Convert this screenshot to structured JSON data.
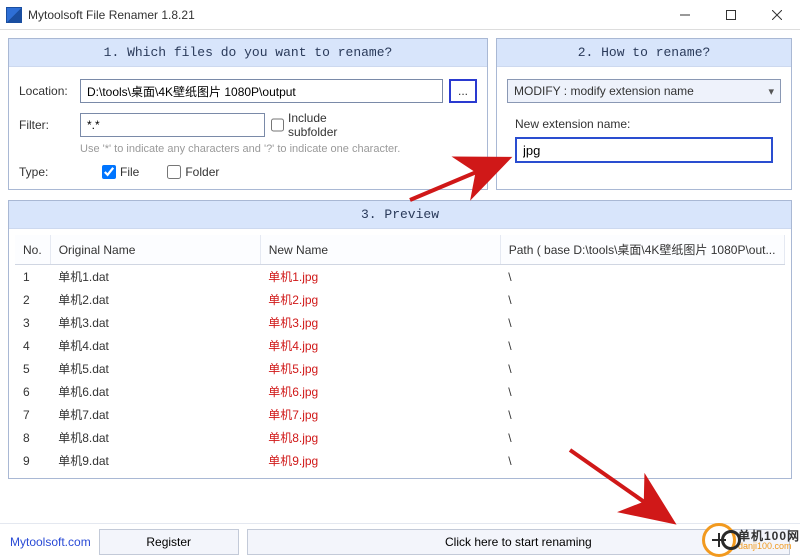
{
  "window": {
    "title": "Mytoolsoft File Renamer 1.8.21"
  },
  "panel1": {
    "title": "1. Which files do you want to rename?",
    "location_label": "Location:",
    "location_value": "D:\\tools\\桌面\\4K壁纸图片 1080P\\output",
    "browse_label": "...",
    "filter_label": "Filter:",
    "filter_value": "*.*",
    "include_subfolder_label": "Include subfolder",
    "include_subfolder_checked": false,
    "hint": "Use '*' to indicate any characters and '?' to indicate one character.",
    "type_label": "Type:",
    "file_label": "File",
    "file_checked": true,
    "folder_label": "Folder",
    "folder_checked": false
  },
  "panel2": {
    "title": "2. How to rename?",
    "mode_selected": "MODIFY : modify extension name",
    "ext_label": "New extension name:",
    "ext_value": "jpg"
  },
  "preview": {
    "title": "3. Preview",
    "columns": {
      "no": "No.",
      "original": "Original Name",
      "newname": "New Name",
      "path": "Path ( base D:\\tools\\桌面\\4K壁纸图片 1080P\\out..."
    },
    "rows": [
      {
        "no": "1",
        "original": "单机1.dat",
        "newname": "单机1.jpg",
        "path": "\\"
      },
      {
        "no": "2",
        "original": "单机2.dat",
        "newname": "单机2.jpg",
        "path": "\\"
      },
      {
        "no": "3",
        "original": "单机3.dat",
        "newname": "单机3.jpg",
        "path": "\\"
      },
      {
        "no": "4",
        "original": "单机4.dat",
        "newname": "单机4.jpg",
        "path": "\\"
      },
      {
        "no": "5",
        "original": "单机5.dat",
        "newname": "单机5.jpg",
        "path": "\\"
      },
      {
        "no": "6",
        "original": "单机6.dat",
        "newname": "单机6.jpg",
        "path": "\\"
      },
      {
        "no": "7",
        "original": "单机7.dat",
        "newname": "单机7.jpg",
        "path": "\\"
      },
      {
        "no": "8",
        "original": "单机8.dat",
        "newname": "单机8.jpg",
        "path": "\\"
      },
      {
        "no": "9",
        "original": "单机9.dat",
        "newname": "单机9.jpg",
        "path": "\\"
      }
    ]
  },
  "footer": {
    "site": "Mytoolsoft.com",
    "register": "Register",
    "start": "Click here to start renaming"
  },
  "watermark": {
    "top": "单机100网",
    "bottom": "danji100.com"
  }
}
